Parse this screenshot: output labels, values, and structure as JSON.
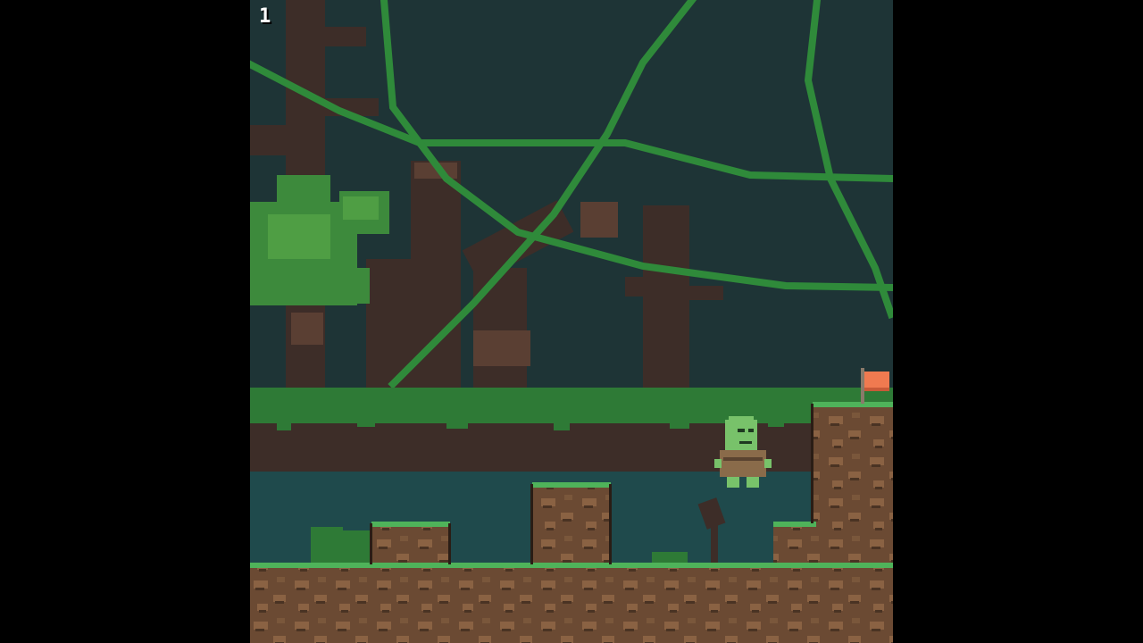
{
  "hud": {
    "level": "1"
  },
  "scene": {
    "sprites": {
      "player": "turtle-character",
      "goal": "orange-goal-flag"
    },
    "colors": {
      "sky": "#1e3436",
      "vine": "#2f8a3a",
      "trunk": "#3d2d28",
      "trunk_light": "#5a3f33",
      "foliage": "#3d8a3c",
      "foliage_light": "#4f9e44",
      "moss": "#2e7a36",
      "water": "#1f4a4c",
      "dirt": "#6b4a33",
      "dirt_dark": "#4a3323",
      "dirt_spot": "#8a6243",
      "grass": "#4fb35a",
      "turtle_skin": "#78c26a",
      "turtle_shell": "#8a6b4a",
      "flag": "#f07a50"
    }
  }
}
